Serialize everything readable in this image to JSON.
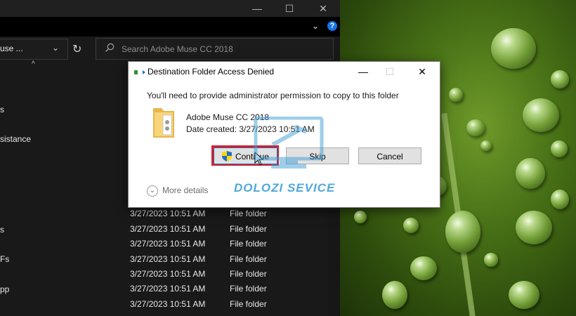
{
  "explorer": {
    "window_controls": {
      "minimize": "—",
      "maximize": "☐",
      "close": "✕"
    },
    "address_text": "use ...",
    "search": {
      "placeholder": "Search Adobe Muse CC 2018"
    },
    "nav_items": [
      "s",
      "sistance",
      "s",
      "Fs",
      "pp"
    ],
    "rows": [
      {
        "date": "3/27/2023 10:51 AM",
        "type": "File folder"
      },
      {
        "date": "3/27/2023 10:51 AM",
        "type": "File folder"
      },
      {
        "date": "3/27/2023 10:51 AM",
        "type": "File folder"
      },
      {
        "date": "3/27/2023 10:51 AM",
        "type": "File folder"
      },
      {
        "date": "3/27/2023 10:51 AM",
        "type": "File folder"
      },
      {
        "date": "3/27/2023 10:51 AM",
        "type": "File folder"
      },
      {
        "date": "3/27/2023 10:51 AM",
        "type": "File folder"
      }
    ]
  },
  "dialog": {
    "title": "Destination Folder Access Denied",
    "message": "You'll need to provide administrator permission to copy to this folder",
    "file": {
      "name": "Adobe Muse CC 2018",
      "date_created": "Date created: 3/27/2023 10:51 AM"
    },
    "buttons": {
      "continue": "Continue",
      "skip": "Skip",
      "cancel": "Cancel"
    },
    "more_details": "More details"
  },
  "watermark": {
    "text": "DOLOZI SEVICE"
  },
  "colors": {
    "highlight": "#e01b24",
    "accent": "#0078d7"
  }
}
